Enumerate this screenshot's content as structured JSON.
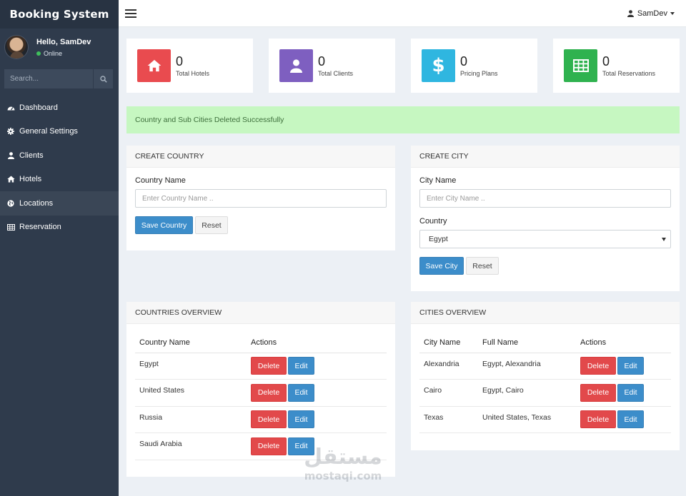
{
  "sidebar": {
    "brand": "Booking System",
    "user": {
      "greeting": "Hello, SamDev",
      "status": "Online"
    },
    "search": {
      "placeholder": "Search..."
    },
    "items": [
      {
        "label": "Dashboard",
        "icon": "dashboard-icon"
      },
      {
        "label": "General Settings",
        "icon": "gear-icon"
      },
      {
        "label": "Clients",
        "icon": "user-icon"
      },
      {
        "label": "Hotels",
        "icon": "home-icon"
      },
      {
        "label": "Locations",
        "icon": "globe-icon",
        "active": true
      },
      {
        "label": "Reservation",
        "icon": "table-icon"
      }
    ]
  },
  "topbar": {
    "user_label": "SamDev"
  },
  "stats": [
    {
      "value": "0",
      "label": "Total Hotels",
      "color": "#e94b4f",
      "icon": "home-icon"
    },
    {
      "value": "0",
      "label": "Total Clients",
      "color": "#7e5fc0",
      "icon": "user-icon"
    },
    {
      "value": "0",
      "label": "Pricing Plans",
      "color": "#2fb6e0",
      "icon": "dollar-icon"
    },
    {
      "value": "0",
      "label": "Total Reservations",
      "color": "#2fb24f",
      "icon": "table-icon"
    }
  ],
  "alert": {
    "message": "Country and Sub Cities Deleted Successfully"
  },
  "create_country": {
    "title": "CREATE COUNTRY",
    "field_label": "Country Name",
    "placeholder": "Enter Country Name ..",
    "save_label": "Save Country",
    "reset_label": "Reset"
  },
  "create_city": {
    "title": "CREATE CITY",
    "field_label": "City Name",
    "placeholder": "Enter City Name ..",
    "country_label": "Country",
    "country_selected": "Egypt",
    "save_label": "Save City",
    "reset_label": "Reset"
  },
  "countries_overview": {
    "title": "COUNTRIES OVERVIEW",
    "columns": [
      "Country Name",
      "Actions"
    ],
    "rows": [
      "Egypt",
      "United States",
      "Russia",
      "Saudi Arabia"
    ],
    "delete_label": "Delete",
    "edit_label": "Edit"
  },
  "cities_overview": {
    "title": "CITIES OVERVIEW",
    "columns": [
      "City Name",
      "Full Name",
      "Actions"
    ],
    "rows": [
      {
        "city": "Alexandria",
        "full": "Egypt, Alexandria"
      },
      {
        "city": "Cairo",
        "full": "Egypt, Cairo"
      },
      {
        "city": "Texas",
        "full": "United States, Texas"
      }
    ],
    "delete_label": "Delete",
    "edit_label": "Edit"
  },
  "watermark": {
    "arabic": "مستقل",
    "latin": "mostaqi.com"
  }
}
